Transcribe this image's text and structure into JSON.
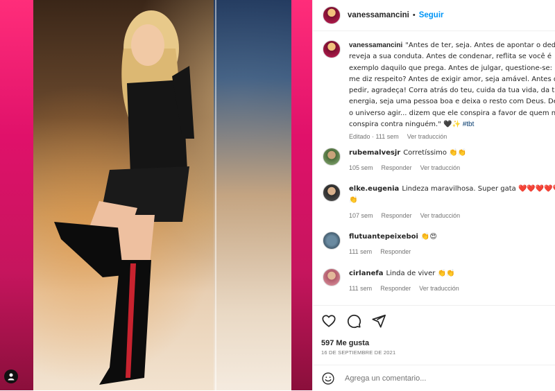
{
  "post": {
    "username": "vanessamancini",
    "follow_label": "Seguir",
    "separator": "•"
  },
  "caption": {
    "username": "vanessamancini",
    "text": "\"Antes de ter, seja. Antes de apontar o dedo, reveja a sua conduta. Antes de condenar, reflita se você é exemplo daquilo que prega. Antes de julgar, questione-se: isso me diz respeito? Antes de exigir amor, seja amável. Antes de pedir, agradeça! Corra atrás do teu, cuida da tua vida, da tua energia, seja uma pessoa boa e deixa o resto com Deus. Deixa o universo agir... dizem que ele conspira a favor de quem não conspira contra ninguém.\" 🖤✨",
    "hashtag": "#tbt",
    "edited": "Editado · 111 sem",
    "translate": "Ver traducción"
  },
  "comments": [
    {
      "username": "rubemalvesjr",
      "text": "Corretíssimo 👏👏",
      "time": "105 sem",
      "reply": "Responder",
      "translate": "Ver traducción"
    },
    {
      "username": "elke.eugenia",
      "text": "Lindeza maravilhosa. Super gata ❤️❤️❤️❤️❤️ 👏",
      "time": "107 sem",
      "reply": "Responder",
      "translate": "Ver traducción"
    },
    {
      "username": "flutuantepeixeboi",
      "text": "👏😍",
      "time": "111 sem",
      "reply": "Responder",
      "translate": ""
    },
    {
      "username": "cirlanefa",
      "text": "Linda de viver 👏👏",
      "time": "111 sem",
      "reply": "Responder",
      "translate": "Ver traducción"
    }
  ],
  "actions": {
    "likes": "597 Me gusta",
    "date": "16 DE SEPTIEMBRE DE 2021",
    "comment_placeholder": "Agrega un comentario..."
  },
  "icons": {
    "like": "heart-icon",
    "comment": "comment-icon",
    "share": "share-icon",
    "emoji": "smiley-icon",
    "profile": "user-icon"
  },
  "colors": {
    "accent": "#0095f6",
    "hashtag": "#00376b",
    "muted": "#737373",
    "media_background": "#e0116a"
  }
}
